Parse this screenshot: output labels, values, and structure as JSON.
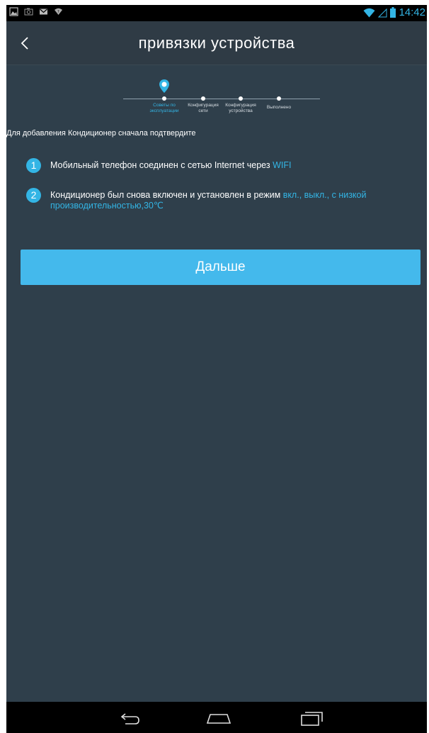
{
  "status_bar": {
    "time": "14:42",
    "icons": [
      "image-icon",
      "camera-icon",
      "mail-icon",
      "wifi-debug-icon",
      "wifi-icon",
      "signal-icon",
      "battery-icon"
    ],
    "accent_color": "#33b5e5"
  },
  "header": {
    "title": "привязки устройства",
    "back_icon": "chevron-left-icon"
  },
  "stepper": {
    "steps": [
      {
        "label_line1": "Советы по",
        "label_line2": "эксплуатации",
        "active": true
      },
      {
        "label_line1": "Конфигурация",
        "label_line2": "сети",
        "active": false
      },
      {
        "label_line1": "Конфигурация",
        "label_line2": "устройства",
        "active": false
      },
      {
        "label_line1": "Выполнено",
        "label_line2": "",
        "active": false
      }
    ]
  },
  "intro_text": "Для добавления Кондиционер сначала подтвердите",
  "items": [
    {
      "number": "1",
      "text": "Мобильный телефон соединен с сетью Internet через ",
      "accent": "WIFI"
    },
    {
      "number": "2",
      "text": "Кондиционер был снова включен и установлен в режим ",
      "accent": "вкл., выкл., с низкой производительностью,30℃"
    }
  ],
  "next_button": "Дальше",
  "nav_bar": {
    "icons": [
      "back-nav-icon",
      "home-nav-icon",
      "recents-nav-icon"
    ]
  },
  "colors": {
    "background": "#2f3f4b",
    "header": "#2f3b45",
    "accent": "#33b5e5",
    "button": "#44b9ec"
  }
}
